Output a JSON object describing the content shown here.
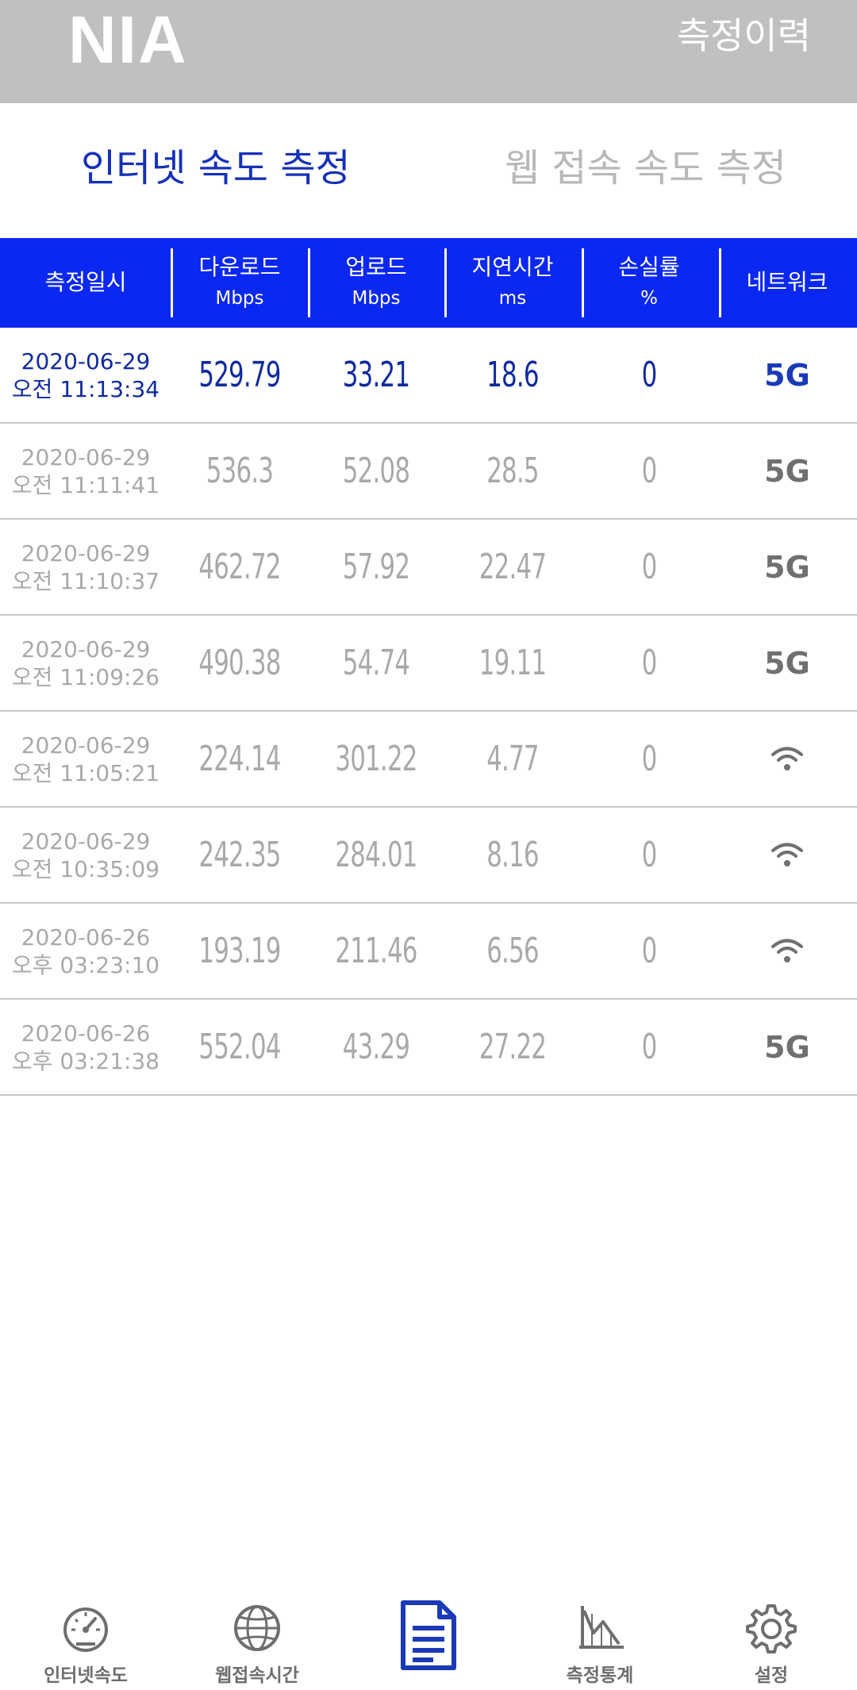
{
  "header": {
    "logo": "NIA",
    "title": "측정이력"
  },
  "tabs": [
    {
      "label": "인터넷 속도 측정",
      "active": true
    },
    {
      "label": "웹 접속 속도 측정",
      "active": false
    }
  ],
  "table": {
    "columns": [
      {
        "label": "측정일시",
        "unit": ""
      },
      {
        "label": "다운로드",
        "unit": "Mbps"
      },
      {
        "label": "업로드",
        "unit": "Mbps"
      },
      {
        "label": "지연시간",
        "unit": "ms"
      },
      {
        "label": "손실률",
        "unit": "%"
      },
      {
        "label": "네트워크",
        "unit": ""
      }
    ],
    "rows": [
      {
        "date": "2020-06-29",
        "time": "오전 11:13:34",
        "download": "529.79",
        "upload": "33.21",
        "latency": "18.6",
        "loss": "0",
        "network": "5G",
        "network_icon": "5g-text"
      },
      {
        "date": "2020-06-29",
        "time": "오전 11:11:41",
        "download": "536.3",
        "upload": "52.08",
        "latency": "28.5",
        "loss": "0",
        "network": "5G",
        "network_icon": "5g-text"
      },
      {
        "date": "2020-06-29",
        "time": "오전 11:10:37",
        "download": "462.72",
        "upload": "57.92",
        "latency": "22.47",
        "loss": "0",
        "network": "5G",
        "network_icon": "5g-text"
      },
      {
        "date": "2020-06-29",
        "time": "오전 11:09:26",
        "download": "490.38",
        "upload": "54.74",
        "latency": "19.11",
        "loss": "0",
        "network": "5G",
        "network_icon": "5g-text"
      },
      {
        "date": "2020-06-29",
        "time": "오전 11:05:21",
        "download": "224.14",
        "upload": "301.22",
        "latency": "4.77",
        "loss": "0",
        "network": "",
        "network_icon": "wifi-icon"
      },
      {
        "date": "2020-06-29",
        "time": "오전 10:35:09",
        "download": "242.35",
        "upload": "284.01",
        "latency": "8.16",
        "loss": "0",
        "network": "",
        "network_icon": "wifi-icon"
      },
      {
        "date": "2020-06-26",
        "time": "오후 03:23:10",
        "download": "193.19",
        "upload": "211.46",
        "latency": "6.56",
        "loss": "0",
        "network": "",
        "network_icon": "wifi-icon"
      },
      {
        "date": "2020-06-26",
        "time": "오후 03:21:38",
        "download": "552.04",
        "upload": "43.29",
        "latency": "27.22",
        "loss": "0",
        "network": "5G",
        "network_icon": "5g-text"
      }
    ]
  },
  "bottom_nav": [
    {
      "label": "인터넷속도",
      "icon": "speedometer-icon",
      "active": false
    },
    {
      "label": "웹접속시간",
      "icon": "globe-icon",
      "active": false
    },
    {
      "label": "",
      "icon": "document-icon",
      "active": true
    },
    {
      "label": "측정통계",
      "icon": "chart-icon",
      "active": false
    },
    {
      "label": "설정",
      "icon": "gear-icon",
      "active": false
    }
  ],
  "colors": {
    "header_bg": "#c0c0c0",
    "table_header_bg": "#0b28f2",
    "active_text": "#1530b8",
    "inactive_text": "#b8b8b8",
    "current_row_text": "#102a9e",
    "nav_active": "#1a3ab8"
  }
}
